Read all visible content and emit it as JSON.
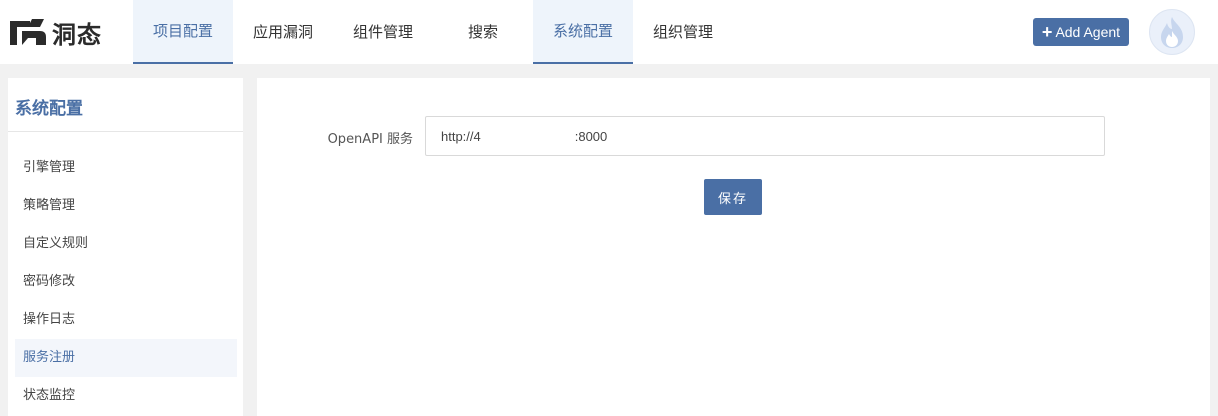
{
  "app": {
    "logo_text": "洞态",
    "logo_icon": "brand-logo-icon"
  },
  "nav": {
    "items": [
      {
        "label": "项目配置",
        "active": true
      },
      {
        "label": "应用漏洞",
        "active": false
      },
      {
        "label": "组件管理",
        "active": false
      },
      {
        "label": "搜索",
        "active": false
      },
      {
        "label": "系统配置",
        "active": true
      },
      {
        "label": "组织管理",
        "active": false
      }
    ]
  },
  "header": {
    "add_agent_label": "Add Agent",
    "add_icon": "plus-icon",
    "avatar_icon": "flame-avatar-icon"
  },
  "sidebar": {
    "title": "系统配置",
    "items": [
      {
        "label": "引擎管理",
        "active": false
      },
      {
        "label": "策略管理",
        "active": false
      },
      {
        "label": "自定义规则",
        "active": false
      },
      {
        "label": "密码修改",
        "active": false
      },
      {
        "label": "操作日志",
        "active": false
      },
      {
        "label": "服务注册",
        "active": true
      },
      {
        "label": "状态监控",
        "active": false
      }
    ]
  },
  "form": {
    "openapi_label": "OpenAPI 服务",
    "openapi_value": "http://4             :8000",
    "save_label": "保存"
  },
  "colors": {
    "accent": "#4a6fa5",
    "active_bg": "#eef4fb",
    "page_bg": "#f1f1f1"
  }
}
